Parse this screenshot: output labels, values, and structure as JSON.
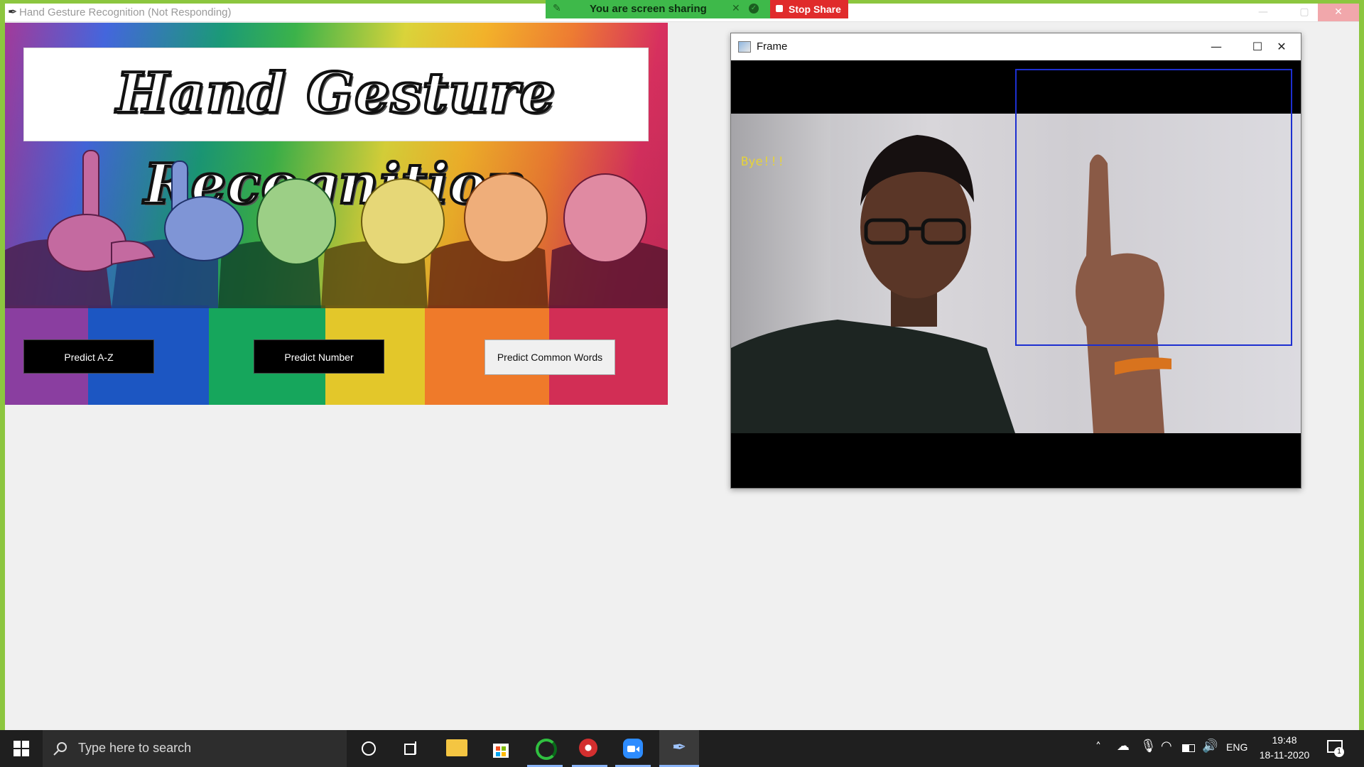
{
  "main_window": {
    "title": "Hand Gesture Recognition (Not Responding)",
    "controls": {
      "minimize": "—",
      "maximize": "▢",
      "close": "✕"
    }
  },
  "share_bar": {
    "status": "You are screen sharing",
    "stop_label": "Stop Share",
    "colors": {
      "bar": "#3eb94a",
      "stop": "#e02b2b"
    }
  },
  "app": {
    "banner_title": "Hand Gesture Recognition",
    "buttons": [
      {
        "label": "Predict A-Z"
      },
      {
        "label": "Predict Number"
      },
      {
        "label": "Predict Common Words"
      }
    ]
  },
  "frame_window": {
    "title": "Frame",
    "overlay_text": "Bye!!!",
    "controls": {
      "minimize": "—",
      "maximize": "☐",
      "close": "✕"
    }
  },
  "taskbar": {
    "search_placeholder": "Type here to search",
    "language": "ENG",
    "time": "19:48",
    "date": "18-11-2020",
    "notification_count": "1"
  }
}
